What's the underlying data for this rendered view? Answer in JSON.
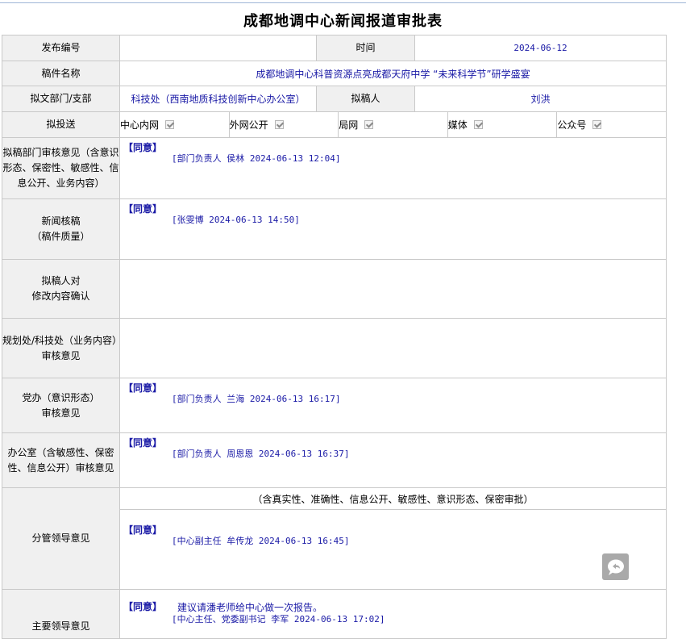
{
  "title": "成都地调中心新闻报道审批表",
  "fields": {
    "pub_no_label": "发布编号",
    "pub_no_value": "",
    "time_label": "时间",
    "time_value": "2024-06-12",
    "manuscript_label": "稿件名称",
    "manuscript_value": "成都地调中心科普资源点亮成都天府中学 “未来科学节”研学盛宴",
    "dept_label": "拟文部门/支部",
    "dept_value": "科技处（西南地质科技创新中心办公室）",
    "author_label": "拟稿人",
    "author_value": "刘洪",
    "send_label": "拟投送"
  },
  "send_options": [
    {
      "label": "中心内网",
      "checked": true
    },
    {
      "label": "外网公开",
      "checked": true
    },
    {
      "label": "局网",
      "checked": true
    },
    {
      "label": "媒体",
      "checked": true
    },
    {
      "label": "公众号",
      "checked": true
    }
  ],
  "reviews": {
    "dept_label": "拟稿部门审核意见（含意识形态、保密性、敏感性、信息公开、业务内容）",
    "dept_opinion": "【同意】",
    "dept_sign": "[部门负责人 侯林 2024-06-13 12:04]",
    "news_label_1": "新闻核稿",
    "news_label_2": "（稿件质量）",
    "news_opinion": "【同意】",
    "news_sign": "[张雯博 2024-06-13 14:50]",
    "confirm_label_1": "拟稿人对",
    "confirm_label_2": "修改内容确认",
    "plan_label_1": "规划处/科技处（业务内容）",
    "plan_label_2": "审核意见",
    "party_label_1": "党办（意识形态）",
    "party_label_2": "审核意见",
    "party_opinion": "【同意】",
    "party_sign": "[部门负责人 兰海 2024-06-13 16:17]",
    "office_label": "办公室（含敏感性、保密性、信息公开）审核意见",
    "office_opinion": "【同意】",
    "office_sign": "[部门负责人 周恩恩 2024-06-13 16:37]",
    "leader_label": "分管领导意见",
    "leader_header": "（含真实性、准确性、信息公开、敏感性、意识形态、保密审批）",
    "leader_opinion": "【同意】",
    "leader_sign": "[中心副主任 牟传龙 2024-06-13 16:45]",
    "main_label": "主要领导意见",
    "main_opinion": "【同意】",
    "main_note": "建议请潘老师给中心做一次报告。",
    "main_sign": "[中心主任、党委副书记 李军 2024-06-13 17:02]"
  },
  "icons": {
    "chat": "chat-bubble-icon"
  }
}
